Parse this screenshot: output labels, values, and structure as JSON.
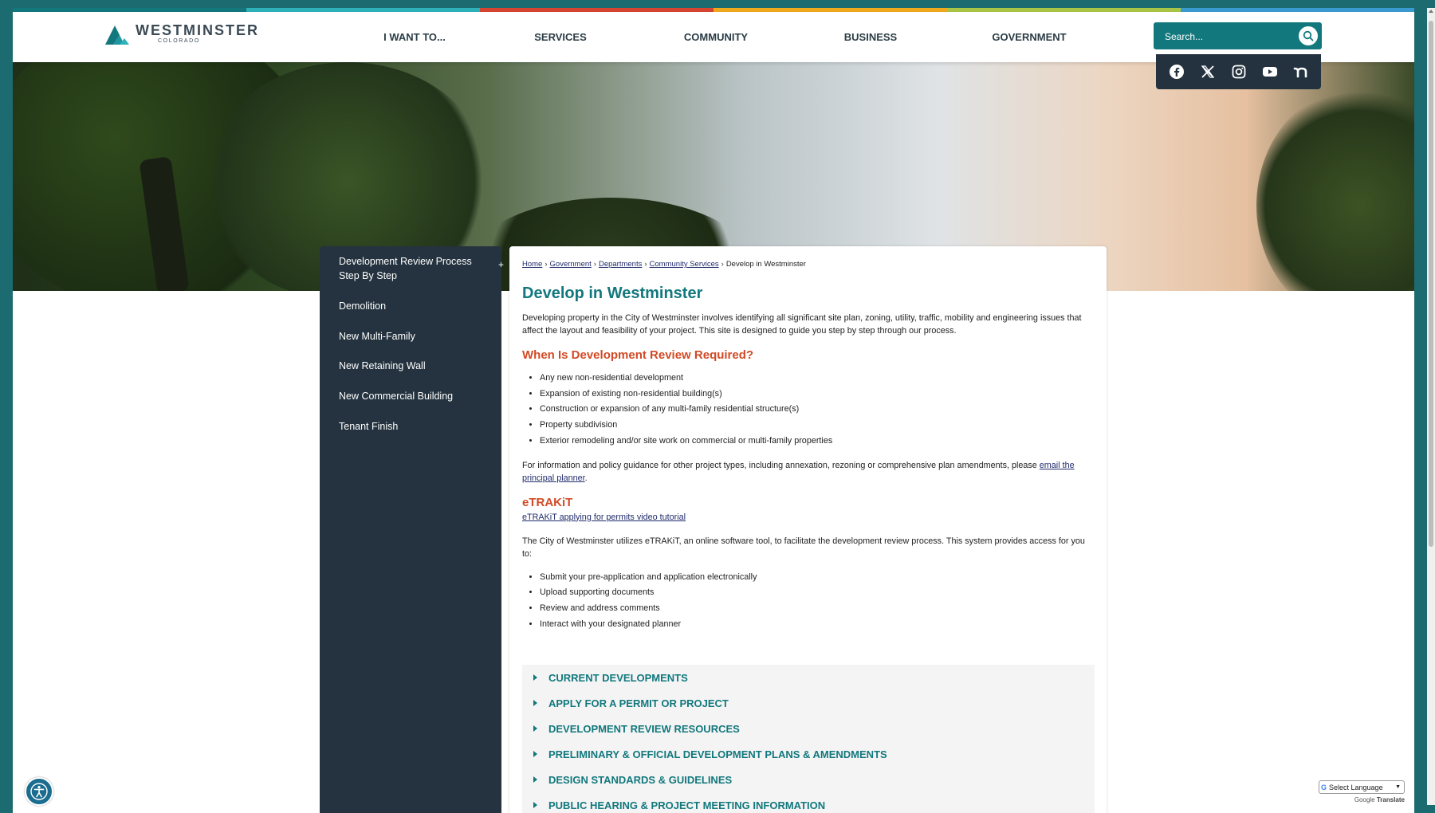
{
  "header": {
    "logo_name": "WESTMINSTER",
    "logo_sub": "COLORADO",
    "nav": [
      {
        "label": "I WANT TO..."
      },
      {
        "label": "SERVICES"
      },
      {
        "label": "COMMUNITY"
      },
      {
        "label": "BUSINESS"
      },
      {
        "label": "GOVERNMENT"
      }
    ],
    "search_placeholder": "Search..."
  },
  "colors": {
    "teal": "#12787d",
    "dark_navy": "#24333f",
    "heading_orange": "#d24a25",
    "strip": [
      "#12787d",
      "#2db1b8",
      "#d64531",
      "#f0a81c",
      "#a8c545",
      "#3a9bd0"
    ]
  },
  "social": [
    "facebook-icon",
    "x-twitter-icon",
    "instagram-icon",
    "youtube-icon",
    "nextdoor-icon"
  ],
  "sidenav": {
    "items": [
      {
        "label": "Development Review Process Step By Step",
        "expandable": "+"
      },
      {
        "label": "Demolition"
      },
      {
        "label": "New Multi-Family"
      },
      {
        "label": "New Retaining Wall"
      },
      {
        "label": "New Commercial Building"
      },
      {
        "label": "Tenant Finish"
      }
    ]
  },
  "breadcrumb": {
    "items": [
      {
        "label": "Home"
      },
      {
        "label": "Government"
      },
      {
        "label": "Departments"
      },
      {
        "label": "Community Services"
      }
    ],
    "sep": "›",
    "current": "Develop in Westminster"
  },
  "content": {
    "title": "Develop in Westminster",
    "intro": "Developing property in the City of Westminster involves identifying all significant site plan, zoning, utility, traffic, mobility and engineering issues that affect the layout and feasibility of your project. This site is designed to guide you step by step through our process.",
    "review_heading": "When Is Development Review Required?",
    "review_list": [
      "Any new non-residential development",
      "Expansion of existing non-residential building(s)",
      "Construction or expansion of any multi-family residential structure(s)",
      "Property subdivision",
      "Exterior remodeling and/or site work on commercial or multi-family properties"
    ],
    "info_text": "For information and policy guidance for other project types, including annexation, rezoning or comprehensive plan amendments, please",
    "info_link": "email the principal planner",
    "info_end": ".",
    "etrakit_heading": "eTRAKiT",
    "etrakit_link": "eTRAKiT applying for permits video tutorial",
    "etrakit_text": "The City of Westminster utilizes eTRAKiT, an online software tool, to facilitate the development review process. This system provides access for you to:",
    "etrakit_list": [
      "Submit your pre-application and application electronically",
      "Upload supporting documents",
      "Review and address comments",
      "Interact with your designated planner"
    ]
  },
  "accordion": [
    {
      "label": "CURRENT DEVELOPMENTS"
    },
    {
      "label": "APPLY FOR A PERMIT OR PROJECT"
    },
    {
      "label": "DEVELOPMENT REVIEW RESOURCES"
    },
    {
      "label": "PRELIMINARY & OFFICIAL DEVELOPMENT PLANS & AMENDMENTS"
    },
    {
      "label": "DESIGN STANDARDS & GUIDELINES"
    },
    {
      "label": "PUBLIC HEARING & PROJECT MEETING INFORMATION"
    }
  ],
  "translate": {
    "select_label": "Select Language",
    "powered_prefix": "Google",
    "powered_word": "Translate"
  }
}
